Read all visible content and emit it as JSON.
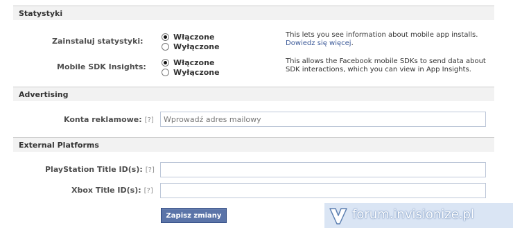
{
  "sections": {
    "stats": {
      "title": "Statystyki"
    },
    "advertising": {
      "title": "Advertising"
    },
    "external": {
      "title": "External Platforms"
    }
  },
  "stats": {
    "install": {
      "label": "Zainstaluj statystyki:",
      "option_on": "Włączone",
      "option_off": "Wyłączone",
      "selected": "Włączone",
      "description": "This lets you see information about mobile app installs.",
      "link": "Dowiedz się więcej",
      "link_suffix": "."
    },
    "sdk": {
      "label": "Mobile SDK Insights:",
      "option_on": "Włączone",
      "option_off": "Wyłączone",
      "selected": "Włączone",
      "description": "This allows the Facebook mobile SDKs to send data about SDK interactions, which you can view in App Insights."
    }
  },
  "advertising": {
    "accounts": {
      "label": "Konta reklamowe:",
      "help": "[?]",
      "placeholder": "Wprowadź adres mailowy",
      "value": ""
    }
  },
  "external": {
    "playstation": {
      "label": "PlayStation Title ID(s):",
      "help": "[?]",
      "value": ""
    },
    "xbox": {
      "label": "Xbox Title ID(s):",
      "help": "[?]",
      "value": ""
    }
  },
  "actions": {
    "save_label": "Zapisz zmiany"
  },
  "watermark": {
    "text": "forum.invisionize.pl"
  },
  "colors": {
    "section_bg": "#f2f2f2",
    "link": "#3b5998",
    "button_bg": "#5b74a8",
    "button_border": "#29447e",
    "input_border": "#bdc7d8"
  }
}
